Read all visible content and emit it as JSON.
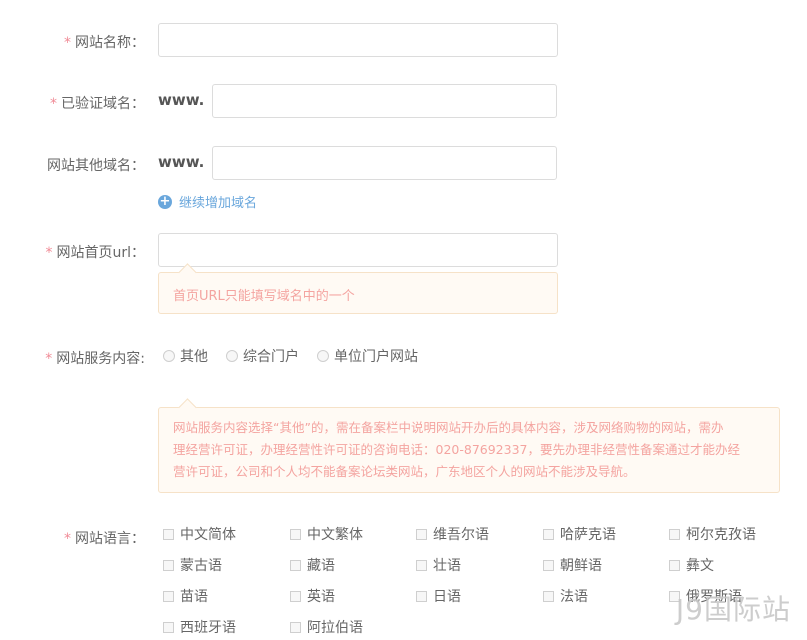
{
  "form": {
    "site_name": {
      "label": "网站名称：",
      "required": true,
      "value": ""
    },
    "verified_domain": {
      "label": "已验证域名：",
      "required": true,
      "prefix": "www.",
      "value": ""
    },
    "other_domains": {
      "label": "网站其他域名：",
      "required": false,
      "prefix": "www.",
      "value": ""
    },
    "add_domain_link": "继续增加域名",
    "homepage_url": {
      "label": "网站首页url：",
      "required": true,
      "value": "",
      "tip": "首页URL只能填写域名中的一个"
    },
    "service_content": {
      "label": "网站服务内容:",
      "required": true,
      "options": [
        "其他",
        "综合门户",
        "单位门户网站"
      ],
      "tip_lines": [
        "网站服务内容选择“其他”的，需在备案栏中说明网站开办后的具体内容，涉及网络购物的网站，需办",
        "理经营许可证，办理经营性许可证的咨询电话：020-87692337，要先办理非经营性备案通过才能办经",
        "营许可证，公司和个人均不能备案论坛类网站，广东地区个人的网站不能涉及导航。"
      ]
    },
    "language": {
      "label": "网站语言：",
      "required": true,
      "options": [
        "中文简体",
        "中文繁体",
        "维吾尔语",
        "哈萨克语",
        "柯尔克孜语",
        "蒙古语",
        "藏语",
        "壮语",
        "朝鲜语",
        "彝文",
        "苗语",
        "英语",
        "日语",
        "法语",
        "俄罗斯语",
        "西班牙语",
        "阿拉伯语"
      ]
    }
  },
  "watermark": "J9国际站",
  "colors": {
    "required_star": "#f08a96",
    "link": "#6aa7dc",
    "tip_text": "#f4a4a0",
    "tip_bg": "#fffaf4",
    "tip_border": "#f6e2c8"
  }
}
